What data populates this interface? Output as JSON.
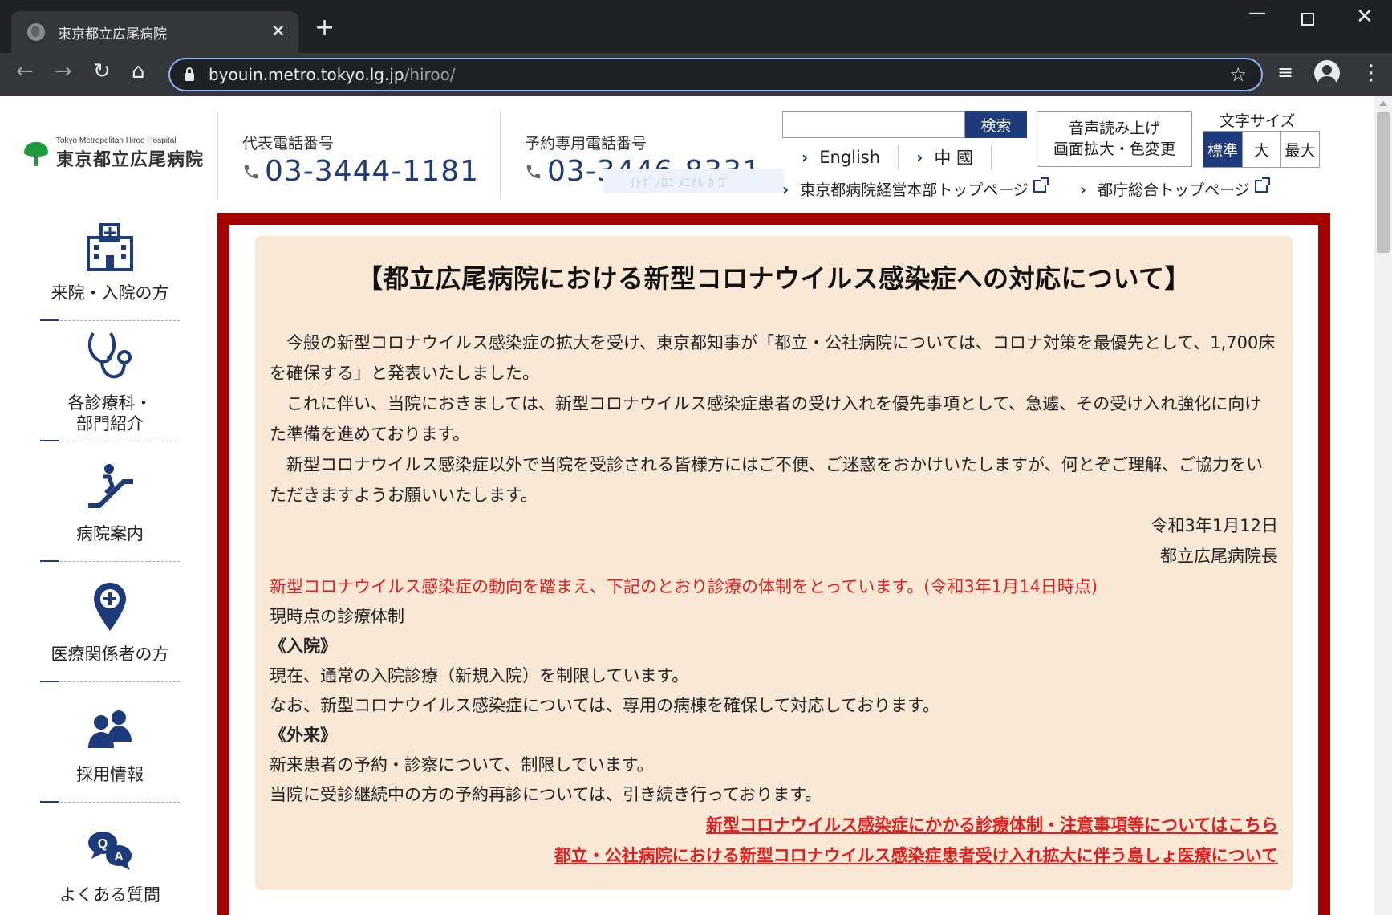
{
  "browser": {
    "tab_title": "東京都立広尾病院",
    "tab_close": "✕",
    "new_tab": "+",
    "url_host": "byouin.metro.tokyo.lg.jp",
    "url_path": "/hiroo/"
  },
  "header": {
    "logo_en": "Tokyo Metropolitan Hiroo Hospital",
    "logo_jp": "東京都立広尾病院",
    "main_phone_label": "代表電話番号",
    "main_phone": "03-3444-1181",
    "reserve_phone_label": "予約専用電話番号",
    "reserve_phone": "03-3446-8331",
    "search_button": "検索",
    "lang_english": "English",
    "lang_chinese": "中 國",
    "voice_line1": "音声読み上げ",
    "voice_line2": "画面拡大・色変更",
    "font_size_label": "文字サイズ",
    "font_standard": "標準",
    "font_large": "大",
    "font_max": "最大",
    "ext_link1": "東京都病院経営本部トップページ",
    "ext_link2": "都庁総合トップページ"
  },
  "leftnav": {
    "items": [
      {
        "label": "来院・入院の方"
      },
      {
        "label": "各診療科・\n部門紹介"
      },
      {
        "label": "病院案内"
      },
      {
        "label": "医療関係者の方"
      },
      {
        "label": "採用情報"
      },
      {
        "label": "よくある質問"
      }
    ]
  },
  "notice": {
    "title": "【都立広尾病院における新型コロナウイルス感染症への対応について】",
    "para1": "今般の新型コロナウイルス感染症の拡大を受け、東京都知事が「都立・公社病院については、コロナ対策を最優先として、1,700床を確保する」と発表いたしました。",
    "para2": "これに伴い、当院におきましては、新型コロナウイルス感染症患者の受け入れを優先事項として、急遽、その受け入れ強化に向けた準備を進めております。",
    "para3": "新型コロナウイルス感染症以外で当院を受診される皆様方にはご不便、ご迷惑をおかけいたしますが、何とぞご理解、ご協力をいただきますようお願いいたします。",
    "date": "令和3年1月12日",
    "signer": "都立広尾病院長",
    "red_notice": "新型コロナウイルス感染症の動向を踏まえ、下記のとおり診療の体制をとっています。(令和3年1月14日時点)",
    "current_system": "現時点の診療体制",
    "inpatient_heading": "《入院》",
    "inpatient_line1": "現在、通常の入院診療（新規入院）を制限しています。",
    "inpatient_line2": "なお、新型コロナウイルス感染症については、専用の病棟を確保して対応しております。",
    "outpatient_heading": "《外来》",
    "outpatient_line1": "新来患者の予約・診察について、制限しています。",
    "outpatient_line2": "当院に受診継続中の方の予約再診については、引き続き行っております。",
    "link1": "新型コロナウイルス感染症にかかる診療体制・注意事項等についてはこちら",
    "link2": "都立・公社病院における新型コロナウイルス感染症患者受け入れ拡大に伴う島しょ医療について"
  },
  "colors": {
    "brand_navy": "#1d3a7a",
    "notice_border": "#a30000",
    "notice_bg": "#fae8d6",
    "alert_red": "#e02020",
    "logo_green": "#1e9a3c"
  }
}
